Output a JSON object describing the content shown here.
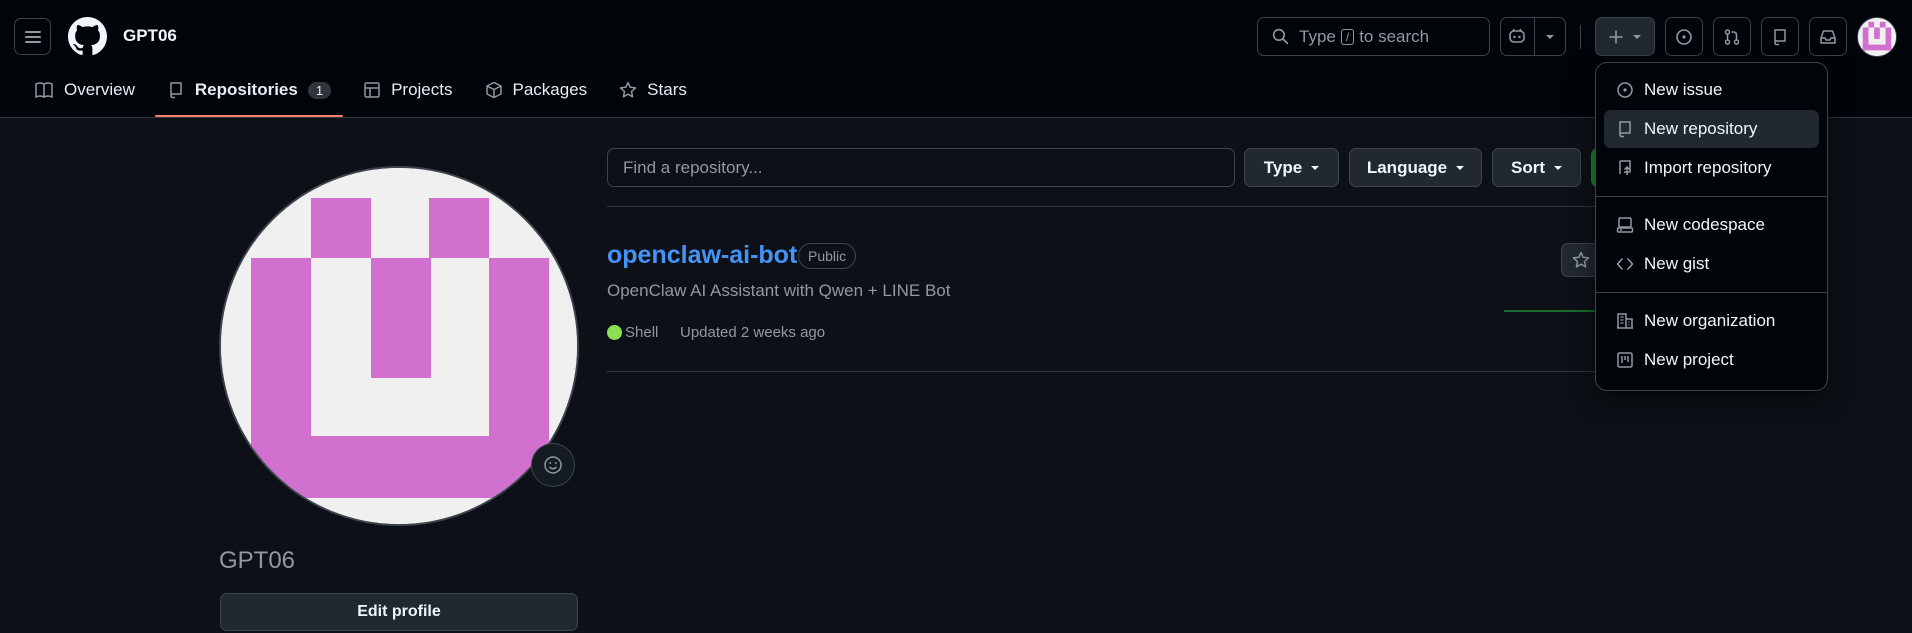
{
  "header": {
    "username": "GPT06",
    "search_prefix": "Type",
    "search_key": "/",
    "search_suffix": "to search"
  },
  "tabs": [
    {
      "label": "Overview"
    },
    {
      "label": "Repositories",
      "count": "1"
    },
    {
      "label": "Projects"
    },
    {
      "label": "Packages"
    },
    {
      "label": "Stars"
    }
  ],
  "profile": {
    "name": "GPT06",
    "edit_label": "Edit profile",
    "avatar_color": "#d270d0"
  },
  "filters": {
    "find_placeholder": "Find a repository...",
    "type_label": "Type",
    "language_label": "Language",
    "sort_label": "Sort"
  },
  "repo": {
    "name": "openclaw-ai-bot",
    "visibility": "Public",
    "description": "OpenClaw AI Assistant with Qwen + LINE Bot",
    "language": "Shell",
    "language_color": "#89e051",
    "updated": "Updated 2 weeks ago"
  },
  "menu": {
    "items": [
      {
        "label": "New issue"
      },
      {
        "label": "New repository"
      },
      {
        "label": "Import repository"
      },
      {
        "label": "New codespace"
      },
      {
        "label": "New gist"
      },
      {
        "label": "New organization"
      },
      {
        "label": "New project"
      }
    ]
  },
  "colors": {
    "accent_tab": "#f78166",
    "link": "#4493f8",
    "background": "#0d1117"
  }
}
